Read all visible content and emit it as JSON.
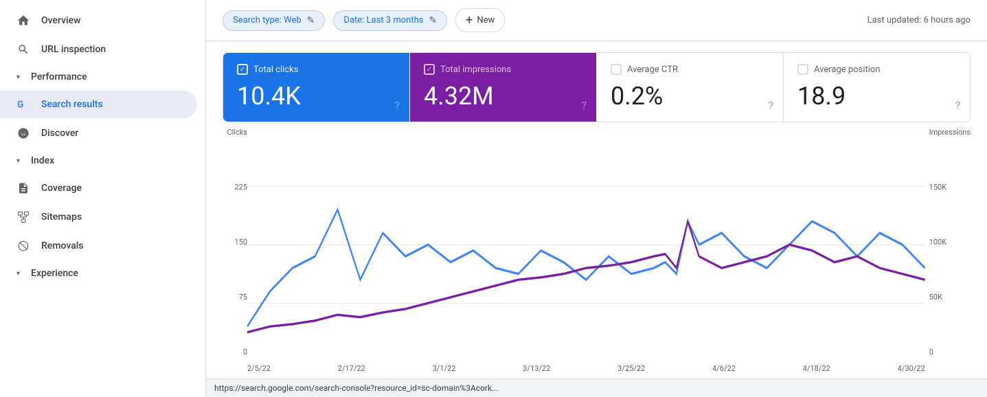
{
  "sidebar": {
    "items": [
      {
        "id": "overview",
        "label": "Overview",
        "icon": "home",
        "active": false,
        "indent": 0
      },
      {
        "id": "url-inspection",
        "label": "URL inspection",
        "icon": "search",
        "active": false,
        "indent": 0
      },
      {
        "id": "performance-header",
        "label": "Performance",
        "icon": "chevron-down",
        "isSection": true
      },
      {
        "id": "search-results",
        "label": "Search results",
        "icon": "google",
        "active": true,
        "indent": 1
      },
      {
        "id": "discover",
        "label": "Discover",
        "icon": "star",
        "active": false,
        "indent": 1
      },
      {
        "id": "index-header",
        "label": "Index",
        "icon": "chevron-down",
        "isSection": true
      },
      {
        "id": "coverage",
        "label": "Coverage",
        "icon": "file",
        "active": false,
        "indent": 1
      },
      {
        "id": "sitemaps",
        "label": "Sitemaps",
        "icon": "sitemap",
        "active": false,
        "indent": 1
      },
      {
        "id": "removals",
        "label": "Removals",
        "icon": "remove",
        "active": false,
        "indent": 1
      },
      {
        "id": "experience-header",
        "label": "Experience",
        "icon": "chevron-down",
        "isSection": true
      }
    ]
  },
  "topbar": {
    "filter1_label": "Search type: Web",
    "filter2_label": "Date: Last 3 months",
    "new_button_label": "New",
    "last_updated": "Last updated: 6 hours ago"
  },
  "metrics": [
    {
      "id": "total-clicks",
      "label": "Total clicks",
      "value": "10.4K",
      "active": "blue",
      "checked": true
    },
    {
      "id": "total-impressions",
      "label": "Total impressions",
      "value": "4.32M",
      "active": "purple",
      "checked": true
    },
    {
      "id": "average-ctr",
      "label": "Average CTR",
      "value": "0.2%",
      "active": false,
      "checked": false
    },
    {
      "id": "average-position",
      "label": "Average position",
      "value": "18.9",
      "active": false,
      "checked": false
    }
  ],
  "chart": {
    "left_axis_label": "Clicks",
    "right_axis_label": "Impressions",
    "left_values": [
      "225",
      "150",
      "75",
      "0"
    ],
    "right_values": [
      "150K",
      "100K",
      "50K",
      "0"
    ],
    "x_labels": [
      "2/5/22",
      "2/17/22",
      "3/1/22",
      "3/13/22",
      "3/25/22",
      "4/6/22",
      "4/18/22",
      "4/30/22"
    ]
  },
  "statusbar": {
    "url": "https://search.google.com/search-console?resource_id=sc-domain%3Acork..."
  }
}
